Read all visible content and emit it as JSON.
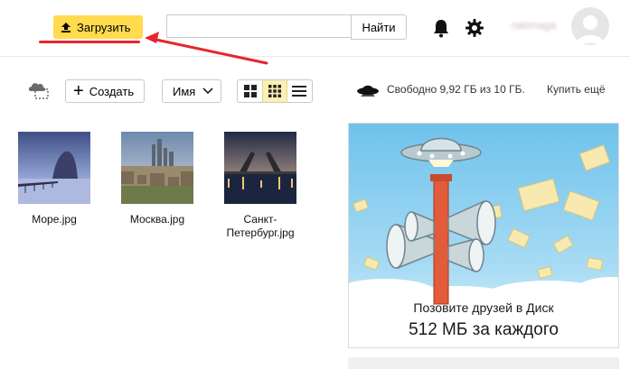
{
  "header": {
    "upload_label": "Загрузить",
    "search_placeholder": "",
    "search_button": "Найти",
    "username": "rakimaga"
  },
  "toolbar": {
    "create_label": "Создать",
    "sort_label": "Имя",
    "quota_text": "Свободно 9,92 ГБ из 10 ГБ.",
    "buy_more": "Купить ещё"
  },
  "files": [
    {
      "name": "Море.jpg"
    },
    {
      "name": "Москва.jpg"
    },
    {
      "name": "Санкт-Петербург.jpg"
    }
  ],
  "ad": {
    "line1": "Позовите друзей в Диск",
    "line2": "512 МБ за каждого"
  },
  "colors": {
    "accent": "#ffdb4d",
    "annotation": "#e8252d",
    "active_view": "#fcefb4"
  }
}
